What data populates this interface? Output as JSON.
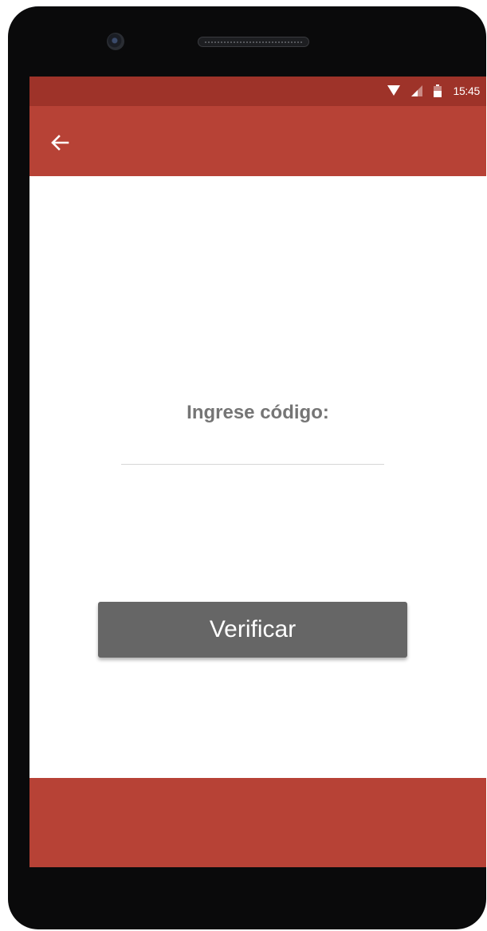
{
  "status_bar": {
    "time": "15:45",
    "icons": [
      "wifi-icon",
      "signal-icon",
      "battery-icon"
    ]
  },
  "app_bar": {
    "back_icon": "arrow-left-icon"
  },
  "form": {
    "code_label": "Ingrese código:",
    "code_value": "",
    "verify_label": "Verificar"
  },
  "colors": {
    "status_bar": "#9e3329",
    "primary": "#b74236",
    "button": "#666666",
    "label_text": "#757575"
  }
}
